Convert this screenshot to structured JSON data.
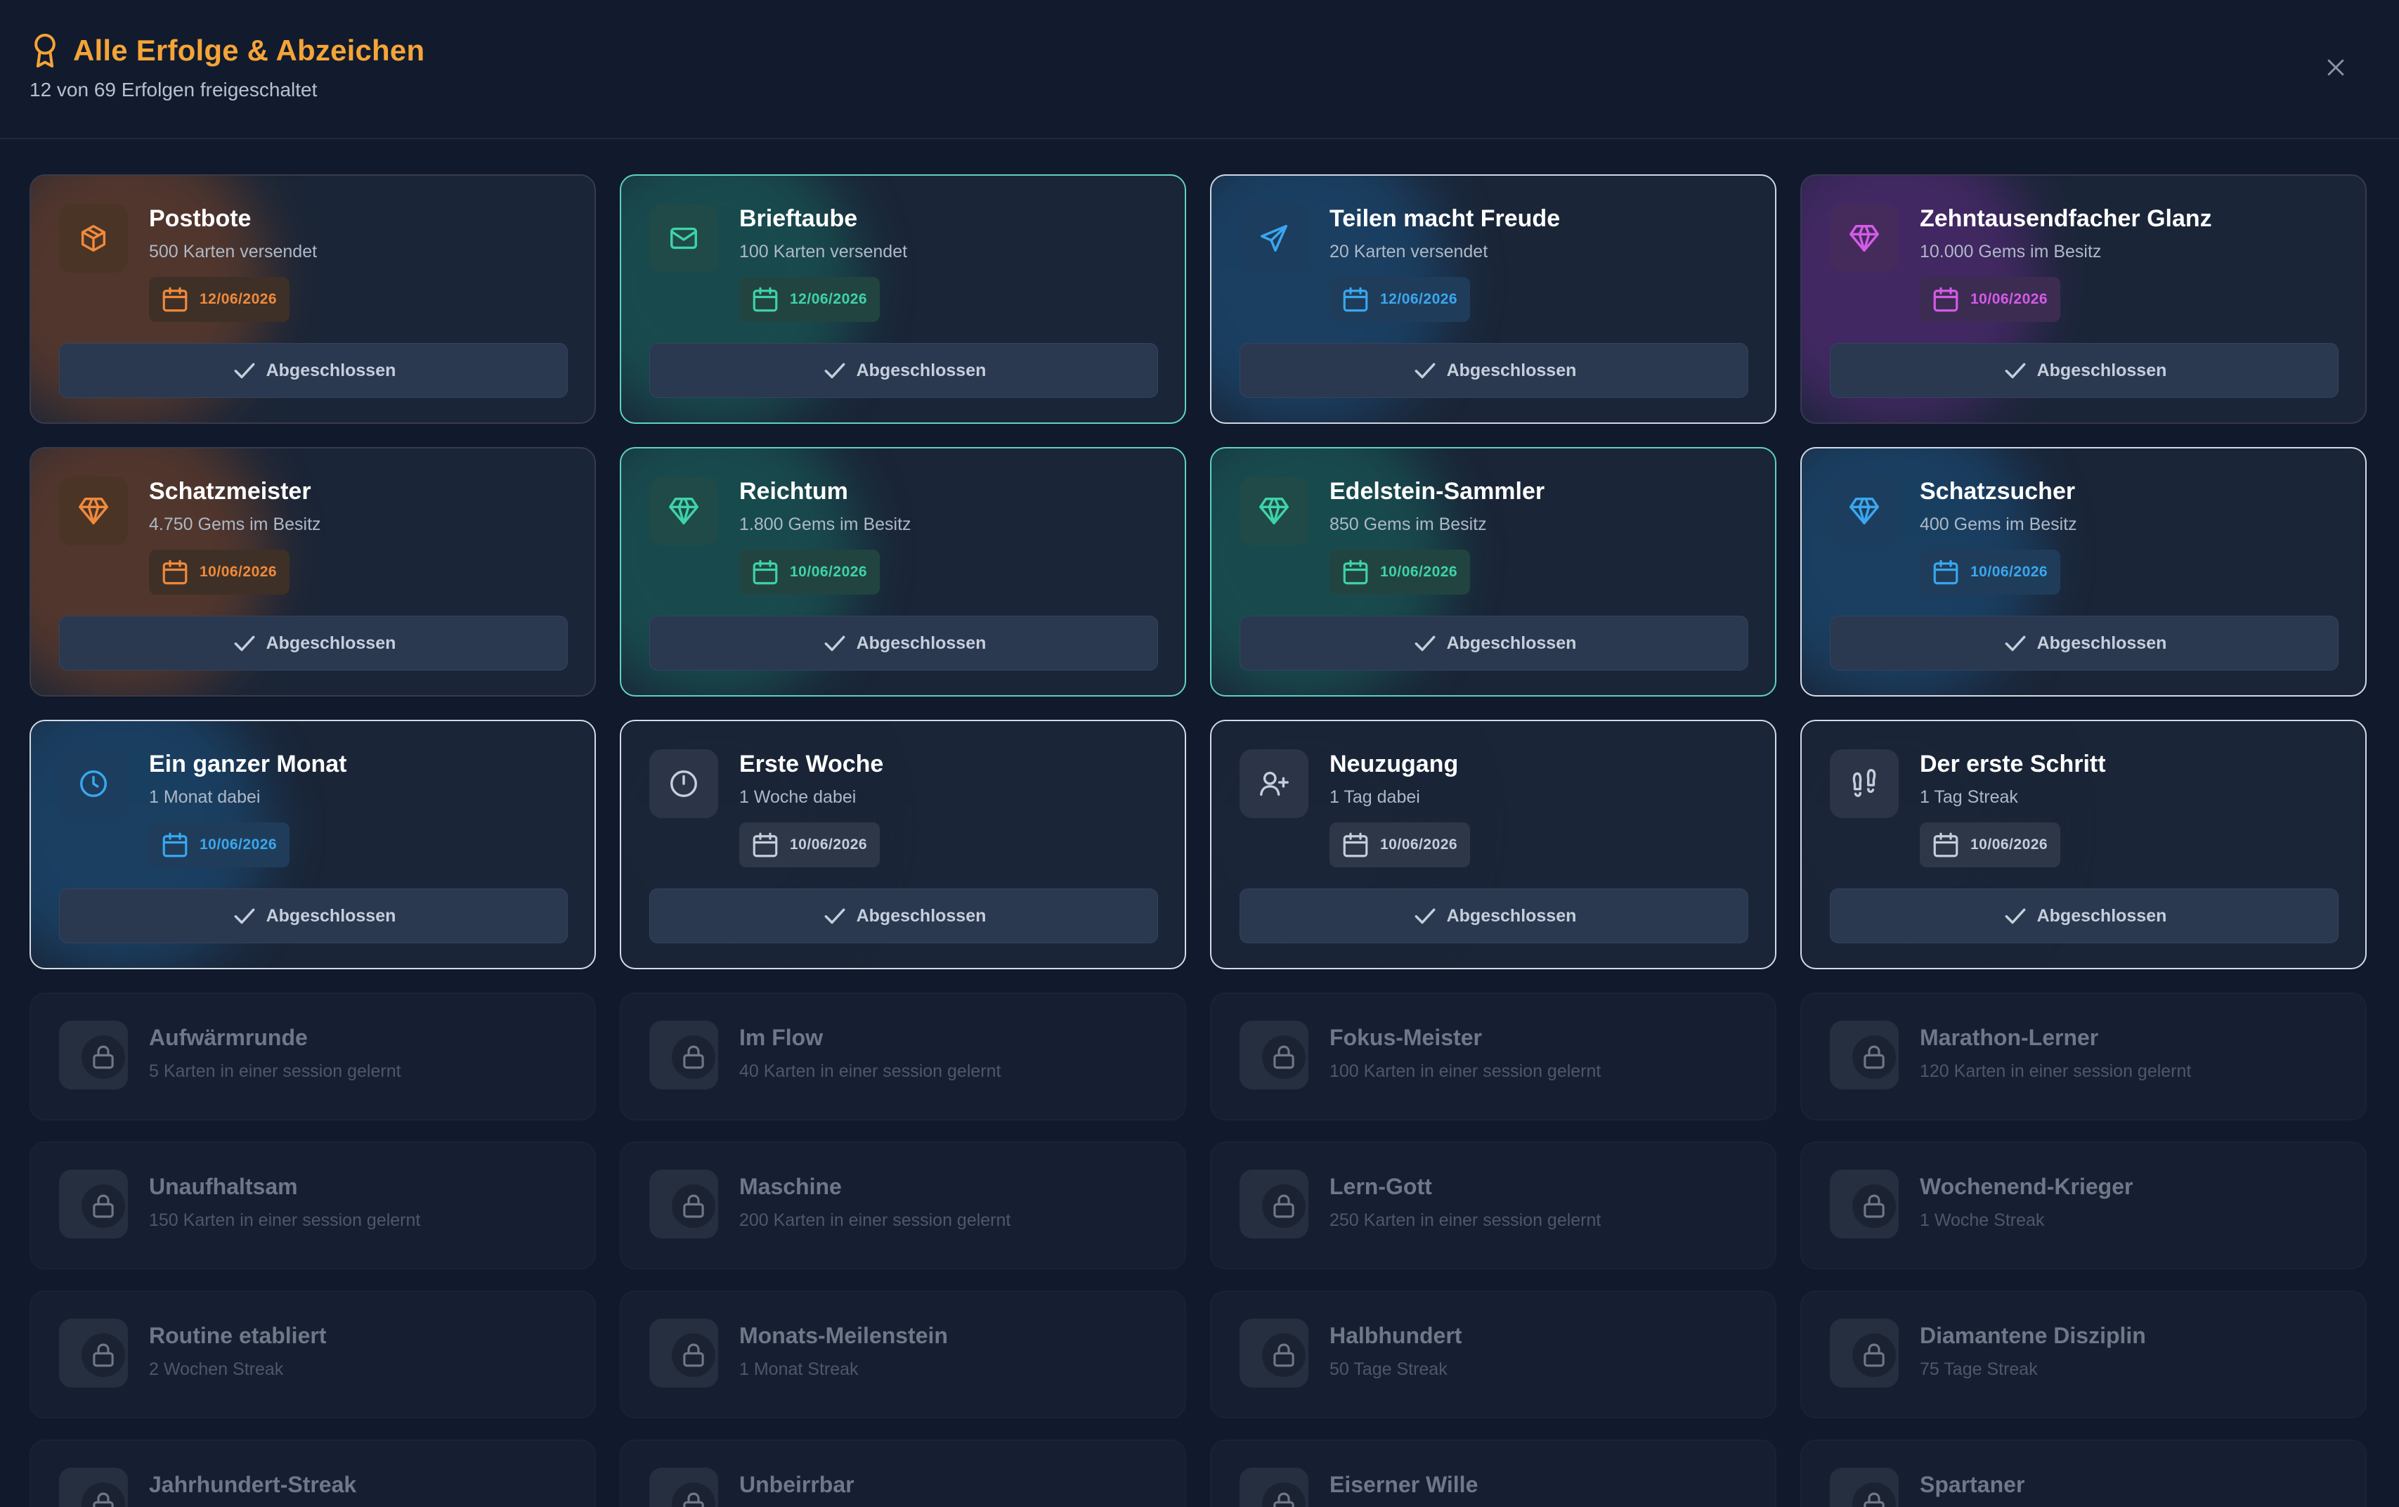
{
  "header": {
    "title": "Alle Erfolge & Abzeichen",
    "subtitle": "12 von 69 Erfolgen freigeschaltet",
    "title_icon": "award-icon",
    "close_icon": "close-icon"
  },
  "colors": {
    "orange": "#f08a3c",
    "teal": "#3ed3a8",
    "blue": "#3aa7f0",
    "purple": "#d35be8",
    "gray": "#c5cedb",
    "title": "#f5a437"
  },
  "done_label": "Abgeschlossen",
  "unlocked": [
    {
      "title": "Postbote",
      "desc": "500 Karten versendet",
      "date": "12/06/2026",
      "theme": "orange",
      "icon": "package-icon"
    },
    {
      "title": "Brieftaube",
      "desc": "100 Karten versendet",
      "date": "12/06/2026",
      "theme": "teal",
      "icon": "mail-icon"
    },
    {
      "title": "Teilen macht Freude",
      "desc": "20 Karten versendet",
      "date": "12/06/2026",
      "theme": "blue",
      "icon": "send-icon"
    },
    {
      "title": "Zehntausendfacher Glanz",
      "desc": "10.000 Gems im Besitz",
      "date": "10/06/2026",
      "theme": "purple",
      "icon": "gem-icon"
    },
    {
      "title": "Schatzmeister",
      "desc": "4.750 Gems im Besitz",
      "date": "10/06/2026",
      "theme": "orange",
      "icon": "gem-icon"
    },
    {
      "title": "Reichtum",
      "desc": "1.800 Gems im Besitz",
      "date": "10/06/2026",
      "theme": "teal",
      "icon": "gem-icon"
    },
    {
      "title": "Edelstein-Sammler",
      "desc": "850 Gems im Besitz",
      "date": "10/06/2026",
      "theme": "teal",
      "icon": "gem-icon"
    },
    {
      "title": "Schatzsucher",
      "desc": "400 Gems im Besitz",
      "date": "10/06/2026",
      "theme": "sky",
      "icon": "gem-icon"
    },
    {
      "title": "Ein ganzer Monat",
      "desc": "1 Monat dabei",
      "date": "10/06/2026",
      "theme": "sky",
      "icon": "clock-icon"
    },
    {
      "title": "Erste Woche",
      "desc": "1 Woche dabei",
      "date": "10/06/2026",
      "theme": "gray",
      "icon": "timer-icon"
    },
    {
      "title": "Neuzugang",
      "desc": "1 Tag dabei",
      "date": "10/06/2026",
      "theme": "gray",
      "icon": "user-plus-icon"
    },
    {
      "title": "Der erste Schritt",
      "desc": "1 Tag Streak",
      "date": "10/06/2026",
      "theme": "gray",
      "icon": "footprints-icon"
    }
  ],
  "locked": [
    {
      "title": "Aufwärmrunde",
      "desc": "5 Karten in einer session gelernt"
    },
    {
      "title": "Im Flow",
      "desc": "40 Karten in einer session gelernt"
    },
    {
      "title": "Fokus-Meister",
      "desc": "100 Karten in einer session gelernt"
    },
    {
      "title": "Marathon-Lerner",
      "desc": "120 Karten in einer session gelernt"
    },
    {
      "title": "Unaufhaltsam",
      "desc": "150 Karten in einer session gelernt"
    },
    {
      "title": "Maschine",
      "desc": "200 Karten in einer session gelernt"
    },
    {
      "title": "Lern-Gott",
      "desc": "250 Karten in einer session gelernt"
    },
    {
      "title": "Wochenend-Krieger",
      "desc": "1 Woche Streak"
    },
    {
      "title": "Routine etabliert",
      "desc": "2 Wochen Streak"
    },
    {
      "title": "Monats-Meilenstein",
      "desc": "1 Monat Streak"
    },
    {
      "title": "Halbhundert",
      "desc": "50 Tage Streak"
    },
    {
      "title": "Diamantene Disziplin",
      "desc": "75 Tage Streak"
    },
    {
      "title": "Jahrhundert-Streak",
      "desc": ""
    },
    {
      "title": "Unbeirrbar",
      "desc": ""
    },
    {
      "title": "Eiserner Wille",
      "desc": ""
    },
    {
      "title": "Spartaner",
      "desc": ""
    }
  ]
}
